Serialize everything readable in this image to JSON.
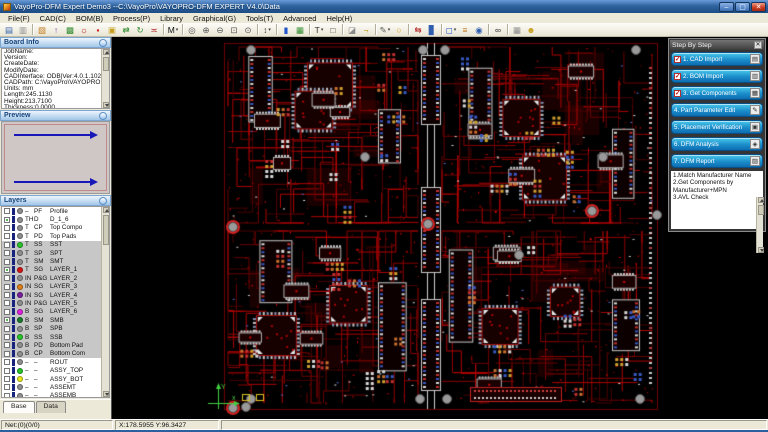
{
  "window": {
    "title": "VayoPro-DFM Expert   Demo3 --C:\\VayoPro\\VAYOPRO-DFM EXPERT V4.0\\Data",
    "controls": {
      "minimize": "–",
      "maximize": "▢",
      "close": "✕"
    }
  },
  "menu": [
    "File(F)",
    "CAD(C)",
    "BOM(B)",
    "Process(P)",
    "Library",
    "Graphical(G)",
    "Tools(T)",
    "Advanced",
    "Help(H)"
  ],
  "toolbar": {
    "caret_glyph": "▾",
    "icons": [
      {
        "name": "save",
        "glyph": "▤",
        "color": "#2f5fae"
      },
      {
        "name": "print",
        "glyph": "▥",
        "color": "#8a8a8a"
      },
      {
        "sep": true
      },
      {
        "name": "paste",
        "glyph": "▧",
        "color": "#c07818"
      },
      {
        "name": "import-cad",
        "glyph": "↑",
        "color": "#7a3fae"
      },
      {
        "name": "board-setup",
        "glyph": "▩",
        "color": "#2e8b2e"
      },
      {
        "name": "settings-gear",
        "glyph": "☼",
        "color": "#b22222"
      },
      {
        "name": "mark",
        "glyph": "▪",
        "color": "#cc2222"
      },
      {
        "name": "open-job",
        "glyph": "▣",
        "color": "#c8a020"
      },
      {
        "name": "swap",
        "glyph": "⇄",
        "color": "#2e8b2e"
      },
      {
        "name": "refresh",
        "glyph": "↻",
        "color": "#2e8b2e"
      },
      {
        "name": "connect",
        "glyph": "≍",
        "color": "#b22222"
      },
      {
        "sep": true
      },
      {
        "name": "mirror-mode",
        "glyph": "M",
        "color": "#111111",
        "caret": true
      },
      {
        "sep": true
      },
      {
        "name": "zoom-fit",
        "glyph": "◎",
        "color": "#555555"
      },
      {
        "name": "zoom-in",
        "glyph": "⊕",
        "color": "#555555"
      },
      {
        "name": "zoom-out",
        "glyph": "⊖",
        "color": "#555555"
      },
      {
        "name": "zoom-window",
        "glyph": "⊡",
        "color": "#555555"
      },
      {
        "name": "zoom-previous",
        "glyph": "⊙",
        "color": "#555555"
      },
      {
        "sep": true
      },
      {
        "name": "level-select",
        "glyph": "↕",
        "color": "#333333",
        "caret": true
      },
      {
        "sep": true
      },
      {
        "name": "highlight",
        "glyph": "▮",
        "color": "#2255cc"
      },
      {
        "name": "grid-table",
        "glyph": "▦",
        "color": "#2e8b2e"
      },
      {
        "sep": true
      },
      {
        "name": "text-edit",
        "glyph": "T",
        "color": "#333333",
        "caret": true
      },
      {
        "name": "query-rect",
        "glyph": "□",
        "color": "#444444"
      },
      {
        "sep": true
      },
      {
        "name": "eraser",
        "glyph": "◪",
        "color": "#8a8a8a"
      },
      {
        "name": "hook-probe",
        "glyph": "¬",
        "color": "#c8a020"
      },
      {
        "sep": true
      },
      {
        "name": "pencil-draw",
        "glyph": "✎",
        "color": "#555555",
        "caret": true
      },
      {
        "name": "lamp-check",
        "glyph": "○",
        "color": "#d8a020"
      },
      {
        "sep": true
      },
      {
        "name": "link-nets",
        "glyph": "⇆",
        "color": "#b22222"
      },
      {
        "name": "library-books",
        "glyph": "▊",
        "color": "#2f5fae"
      },
      {
        "sep": true
      },
      {
        "name": "frame-tool",
        "glyph": "◻",
        "color": "#2255cc",
        "caret": true
      },
      {
        "name": "color-bars",
        "glyph": "≡",
        "color": "#c07818"
      },
      {
        "name": "search-view",
        "glyph": "◉",
        "color": "#2f5fae"
      },
      {
        "sep": true
      },
      {
        "name": "binoculars-find",
        "glyph": "∞",
        "color": "#333333"
      },
      {
        "sep": true
      },
      {
        "name": "component-pkg",
        "glyph": "▦",
        "color": "#8a8a8a"
      },
      {
        "name": "user-profile",
        "glyph": "☻",
        "color": "#c8a020"
      }
    ]
  },
  "panels": {
    "board_info": {
      "title": "Board Info",
      "lines": [
        "JobName:",
        "Version:",
        "CreateDate:",
        "ModifyDate:",
        "CADInterface: ODB|Ver:4.0.1.102",
        "CADPath: C:\\VayoPro\\VAYOPRO",
        "Units: mm",
        "Length:245.1130",
        "Height:213.7100",
        "Thickness:0.0000"
      ]
    },
    "preview": {
      "title": "Preview"
    },
    "layers": {
      "title": "Layers",
      "rows": [
        {
          "side": "–",
          "type": "PF",
          "name": "Profile",
          "color": "#8f8f8f",
          "checked": false,
          "selected": false
        },
        {
          "side": "TH",
          "type": "D",
          "name": "D_1_6",
          "color": "#8f8f8f",
          "checked": true,
          "selected": false
        },
        {
          "side": "T",
          "type": "CP",
          "name": "Top Compo",
          "color": "#8f8f8f",
          "checked": false,
          "selected": false
        },
        {
          "side": "T",
          "type": "PD",
          "name": "Top Pads",
          "color": "#8f8f8f",
          "checked": false,
          "selected": false
        },
        {
          "side": "T",
          "type": "SS",
          "name": "SST",
          "color": "#27c427",
          "checked": false,
          "selected": true
        },
        {
          "side": "T",
          "type": "SP",
          "name": "SPT",
          "color": "#8f8f8f",
          "checked": false,
          "selected": true
        },
        {
          "side": "T",
          "type": "SM",
          "name": "SMT",
          "color": "#8f8f8f",
          "checked": false,
          "selected": true
        },
        {
          "side": "T",
          "type": "SG",
          "name": "LAYER_1",
          "color": "#d81414",
          "checked": true,
          "selected": true
        },
        {
          "side": "IN",
          "type": "P&G",
          "name": "LAYER_2",
          "color": "#8f8f8f",
          "checked": false,
          "selected": true
        },
        {
          "side": "IN",
          "type": "SG",
          "name": "LAYER_3",
          "color": "#e08018",
          "checked": false,
          "selected": true
        },
        {
          "side": "IN",
          "type": "SG",
          "name": "LAYER_4",
          "color": "#7a1f9e",
          "checked": false,
          "selected": true
        },
        {
          "side": "IN",
          "type": "P&G",
          "name": "LAYER_5",
          "color": "#8f8f8f",
          "checked": false,
          "selected": true
        },
        {
          "side": "B",
          "type": "SG",
          "name": "LAYER_6",
          "color": "#e020e0",
          "checked": false,
          "selected": true
        },
        {
          "side": "B",
          "type": "SM",
          "name": "SMB",
          "color": "#1a7a2a",
          "checked": true,
          "selected": true
        },
        {
          "side": "B",
          "type": "SP",
          "name": "SPB",
          "color": "#8f8f8f",
          "checked": false,
          "selected": true
        },
        {
          "side": "B",
          "type": "SS",
          "name": "SSB",
          "color": "#27c427",
          "checked": false,
          "selected": true
        },
        {
          "side": "B",
          "type": "PD",
          "name": "Bottom Pad",
          "color": "#8f8f8f",
          "checked": false,
          "selected": true
        },
        {
          "side": "B",
          "type": "CP",
          "name": "Bottom Com",
          "color": "#8f8f8f",
          "checked": false,
          "selected": true
        },
        {
          "side": "–",
          "type": "–",
          "name": "ROUT",
          "color": "#8f8f8f",
          "checked": false,
          "selected": false
        },
        {
          "side": "–",
          "type": "–",
          "name": "ASSY_TOP",
          "color": "#27c427",
          "checked": false,
          "selected": false
        },
        {
          "side": "–",
          "type": "–",
          "name": "ASSY_BOT",
          "color": "#e8e818",
          "checked": false,
          "selected": false
        },
        {
          "side": "–",
          "type": "–",
          "name": "ASSEMT",
          "color": "#8f8f8f",
          "checked": false,
          "selected": false
        },
        {
          "side": "–",
          "type": "–",
          "name": "ASSEMB",
          "color": "#8f8f8f",
          "checked": false,
          "selected": false
        }
      ]
    }
  },
  "tabs": [
    {
      "label": "Base",
      "active": true
    },
    {
      "label": "Data",
      "active": false
    }
  ],
  "steps": {
    "title": "Step By Step",
    "close_glyph": "✕",
    "check_glyph": "✓",
    "items": [
      {
        "label": "1. CAD Import",
        "checked": true,
        "icon": "▤"
      },
      {
        "label": "2. BOM Import",
        "checked": true,
        "icon": "▥"
      },
      {
        "label": "3. Get Components",
        "checked": true,
        "icon": "▦"
      },
      {
        "label": "4. Part Parameter Edit",
        "checked": false,
        "icon": "✎"
      },
      {
        "label": "5. Placement Verification",
        "checked": false,
        "icon": "▣"
      },
      {
        "label": "6. DFM Analysis",
        "checked": false,
        "icon": "◈"
      },
      {
        "label": "7. DFM Report",
        "checked": false,
        "icon": "▨"
      }
    ],
    "note": "1.Match Manufacturer Name\n2.Get Components by\nManufacturer+MPN\n3.AVL Check"
  },
  "statusbar": {
    "net": "Net:(0)(0/0)",
    "coords": "X:178.5955 Y:96.3427"
  },
  "canvas": {
    "bg": "#000000",
    "trace_reds": [
      "#4a0000",
      "#6b0101",
      "#8d0202",
      "#b00404",
      "#d40606"
    ],
    "pad_colors": [
      "#d8d8d8",
      "#c03030",
      "#3858c0",
      "#d0a030",
      "#c87030"
    ],
    "hole_gray": "#9a9a9a",
    "ring_red": "#d42222",
    "origin_labels": {
      "y": "Y",
      "x": "x"
    }
  }
}
